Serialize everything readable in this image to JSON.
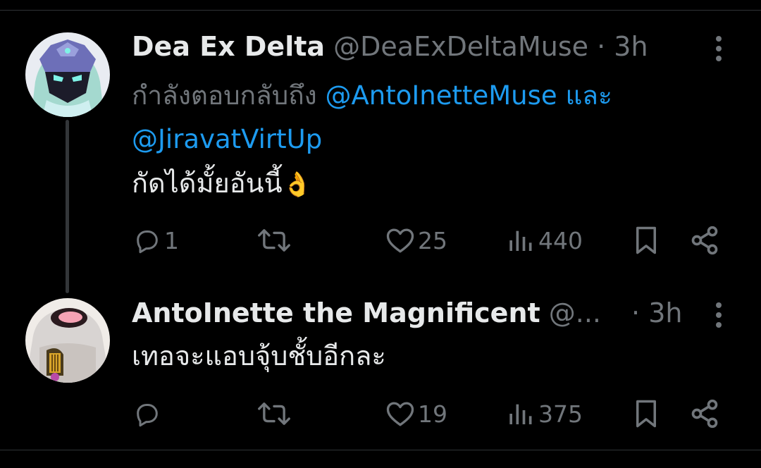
{
  "tweets": [
    {
      "display_name": "Dea Ex Delta",
      "handle": "@DeaExDeltaMuse",
      "separator": "·",
      "time": "3h",
      "reply_prefix": "กำลังตอบกลับถึง",
      "reply_mention_1": "@AntoInetteMuse",
      "reply_conj": "และ",
      "reply_mention_2": "@JiravatVirtUp",
      "text": "กัดได้มั้ยอันนี้",
      "emoji": "👌",
      "replies": "1",
      "retweets": "",
      "likes": "25",
      "views": "440"
    },
    {
      "display_name": "AntoInette the Magnificent",
      "handle": "@...",
      "separator": "·",
      "time": "3h",
      "text": "เทอจะแอบจุ้บชั้บอีกละ",
      "replies": "",
      "retweets": "",
      "likes": "19",
      "views": "375"
    }
  ],
  "colors": {
    "background": "#000000",
    "text": "#e7e9ea",
    "secondary": "#71767b",
    "link": "#1d9bf0",
    "divider": "#2f3336"
  },
  "icons": [
    "reply-icon",
    "retweet-icon",
    "like-icon",
    "views-icon",
    "bookmark-icon",
    "share-icon",
    "more-icon"
  ]
}
